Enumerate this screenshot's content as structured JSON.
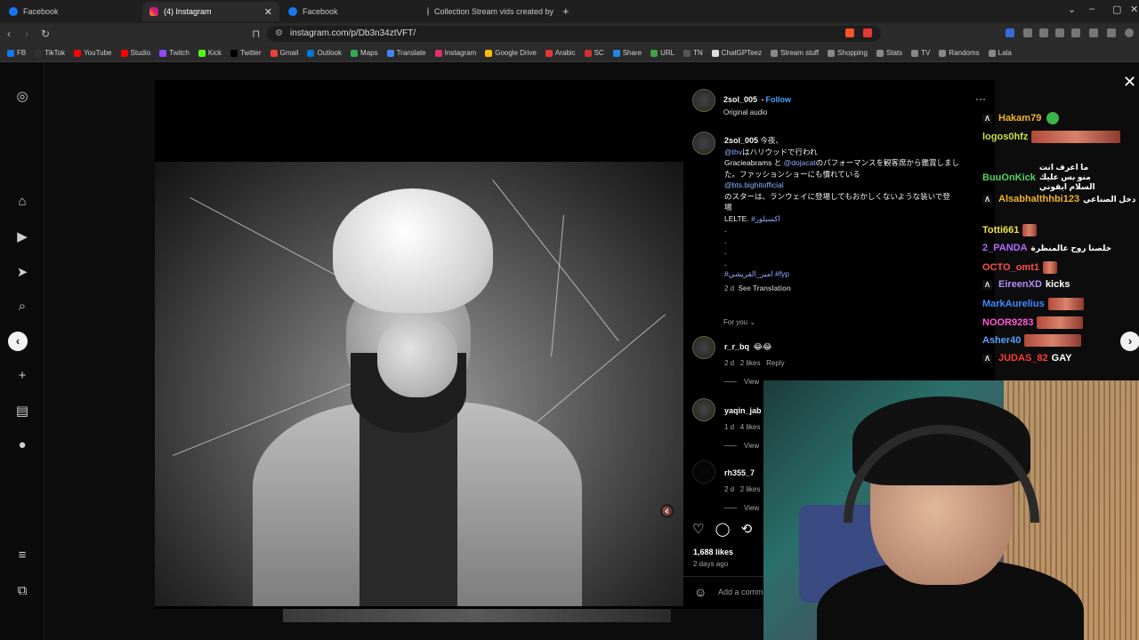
{
  "browser": {
    "tabs": [
      {
        "label": "Facebook",
        "favicon": "facebook-icon"
      },
      {
        "label": "(4) Instagram",
        "favicon": "instagram-icon"
      },
      {
        "label": "Facebook",
        "favicon": "facebook-icon"
      },
      {
        "label": "Collection Stream vids created by ko",
        "favicon": "tiktok-icon"
      }
    ],
    "url": "instagram.com/p/Db3n34ztVFT/",
    "bookmarks": [
      {
        "label": "FB",
        "color": "#1877f2"
      },
      {
        "label": "TikTok",
        "color": "#333333"
      },
      {
        "label": "YouTube",
        "color": "#ff0000"
      },
      {
        "label": "Studio",
        "color": "#ff0000"
      },
      {
        "label": "Twitch",
        "color": "#9146ff"
      },
      {
        "label": "Kick",
        "color": "#53fc18"
      },
      {
        "label": "Twitter",
        "color": "#000000"
      },
      {
        "label": "Gmail",
        "color": "#ea4335"
      },
      {
        "label": "Outlook",
        "color": "#0078d4"
      },
      {
        "label": "Maps",
        "color": "#34a853"
      },
      {
        "label": "Translate",
        "color": "#4285f4"
      },
      {
        "label": "Instagram",
        "color": "#e1306c"
      },
      {
        "label": "Google Drive",
        "color": "#fbbc04"
      },
      {
        "label": "Arabic",
        "color": "#e53935"
      },
      {
        "label": "SC",
        "color": "#d32f2f"
      },
      {
        "label": "Share",
        "color": "#1e88e5"
      },
      {
        "label": "URL",
        "color": "#43a047"
      },
      {
        "label": "TN",
        "color": "#555555"
      },
      {
        "label": "ChatGPTeez",
        "color": "#dddddd"
      },
      {
        "label": "Stream stuff",
        "color": "#888888"
      },
      {
        "label": "Shopping",
        "color": "#888888"
      },
      {
        "label": "Stats",
        "color": "#888888"
      },
      {
        "label": "TV",
        "color": "#888888"
      },
      {
        "label": "Randoms",
        "color": "#888888"
      },
      {
        "label": "Lala",
        "color": "#888888"
      }
    ]
  },
  "post": {
    "author": "2sol_005",
    "follow": "Follow",
    "audio": "Original audio",
    "caption_user": "2sol_005",
    "caption_lines": [
      "今夜、",
      "@thv",
      "はハリウッドで行われ",
      "Gracieabrams と",
      "@dojacat",
      "のパフォーマンスを観客席から鑑賞しました。ファッションショーにも慣れている",
      "@bts.bighitofficial",
      "のスターは、ランウェイに登場してもおかしくないような装いで登",
      "場",
      "LELTE.",
      "#اكسبلور",
      ".",
      ".",
      ".",
      ".",
      "#امير_القريشي #fyp"
    ],
    "caption_time": "2 d",
    "see_translation": "See Translation",
    "for_you": "For you",
    "comments": [
      {
        "user": "r_r_bq",
        "text": "😂😂",
        "time": "2 d",
        "likes": "2 likes",
        "reply": "Reply",
        "view": "View"
      },
      {
        "user": "yaqin_jab",
        "text": "",
        "time": "1 d",
        "likes": "4 likes",
        "reply": "",
        "view": "View"
      },
      {
        "user": "rh355_7",
        "text": "",
        "time": "2 d",
        "likes": "2 likes",
        "reply": "",
        "view": "View"
      }
    ],
    "like_count": "1,688 likes",
    "posted": "2 days ago",
    "add_comment": "Add a comm"
  },
  "chat": [
    {
      "user": "Hakam79",
      "color": "#f0b429",
      "msg": "",
      "emote_w": 0
    },
    {
      "user": "logos0hfz",
      "color": "#c6e04a",
      "msg": "",
      "emote_w": 100
    },
    {
      "user": "BuuOnKick",
      "color": "#55d35f",
      "msg": "ما اعرف انت منو بس عليك السلام ايقوني",
      "emote_w": 0
    },
    {
      "user": "Alsabhalthhbi123",
      "color": "#f0b429",
      "msg": "دخل الصناعي",
      "emote_w": 0
    },
    {
      "user": "Totti661",
      "color": "#f0e04a",
      "msg": "",
      "emote_w": 16
    },
    {
      "user": "2_PANDA",
      "color": "#b36bff",
      "msg": "خلصنا روح عالمنظرة",
      "emote_w": 0
    },
    {
      "user": "OCTO_omt1",
      "color": "#ff4d4d",
      "msg": "",
      "emote_w": 16
    },
    {
      "user": "EireenXD",
      "color": "#b58bff",
      "msg": "kicks",
      "emote_w": 0
    },
    {
      "user": "MarkAurelius",
      "color": "#3b8bff",
      "msg": "",
      "emote_w": 40
    },
    {
      "user": "NOOR9283",
      "color": "#ff5ad7",
      "msg": "",
      "emote_w": 52
    },
    {
      "user": "Asher40",
      "color": "#5aa0ff",
      "msg": "",
      "emote_w": 64
    },
    {
      "user": "JUDAS_82",
      "color": "#ff3b3b",
      "msg": "GAY",
      "emote_w": 0
    }
  ]
}
